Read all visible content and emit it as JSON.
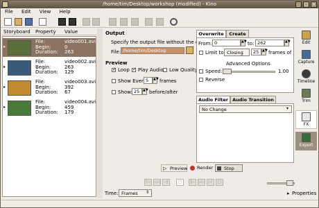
{
  "window": {
    "title": "/home/tim/Desktop/workshop (modified) - Kino"
  },
  "menu": [
    "File",
    "Edit",
    "View",
    "Help"
  ],
  "storyboard": {
    "headers": {
      "storyboard": "Storyboard",
      "property": "Property",
      "value": "Value"
    },
    "clips": [
      {
        "file_label": "File:",
        "file": "video001.avi",
        "begin_label": "Begin:",
        "begin": "0",
        "duration_label": "Duration:",
        "duration": "263",
        "selected": true,
        "thumb_color": "#5a6e3a"
      },
      {
        "file_label": "File:",
        "file": "video002.avi",
        "begin_label": "Begin:",
        "begin": "263",
        "duration_label": "Duration:",
        "duration": "129",
        "selected": false,
        "thumb_color": "#3a5a7a"
      },
      {
        "file_label": "File:",
        "file": "video003.avi",
        "begin_label": "Begin:",
        "begin": "392",
        "duration_label": "Duration:",
        "duration": "67",
        "selected": false,
        "thumb_color": "#c08a30"
      },
      {
        "file_label": "File:",
        "file": "video004.avi",
        "begin_label": "Begin:",
        "begin": "459",
        "duration_label": "Duration:",
        "duration": "179",
        "selected": false,
        "thumb_color": "#4a7a3a"
      }
    ]
  },
  "output": {
    "heading": "Output",
    "hint": "Specify the output file without the extensi",
    "file_label": "File:",
    "file_value": "/home/tim/Desktop"
  },
  "preview": {
    "heading": "Preview",
    "loop": "Loop",
    "play_audio": "Play Audio",
    "low_quality": "Low Quality",
    "show_every": "Show Every:",
    "show_every_value": "5",
    "frames": "frames",
    "show": "Show:",
    "show_value": "25",
    "before_after": "before/after"
  },
  "overwrite": {
    "tab_overwrite": "Overwrite",
    "tab_create": "Create",
    "from_label": "From:",
    "from_value": "0",
    "to_label": "to:",
    "to_value": "262",
    "limit_to": "Limit to:",
    "limit_mode": "Closing",
    "limit_value": "25",
    "frames_of": "frames of",
    "advanced": "Advanced Options",
    "speed": "Speed:",
    "speed_value": "1.00",
    "reverse": "Reverse"
  },
  "audio": {
    "tab_filter": "Audio Filter",
    "tab_transition": "Audio Transition",
    "filter_value": "No Change"
  },
  "render_bar": {
    "preview": "Preview",
    "render": "Render",
    "stop": "Stop"
  },
  "sidebar": [
    {
      "label": "Edit",
      "icon": "edit-icon"
    },
    {
      "label": "Capture",
      "icon": "capture-icon"
    },
    {
      "label": "Timeline",
      "icon": "timeline-icon"
    },
    {
      "label": "Trim",
      "icon": "trim-icon"
    },
    {
      "label": "FX",
      "icon": "fx-icon"
    },
    {
      "label": "Export",
      "icon": "export-icon"
    }
  ],
  "status": {
    "time_label": "Time:",
    "time_mode": "Frames",
    "properties": "Properties"
  }
}
